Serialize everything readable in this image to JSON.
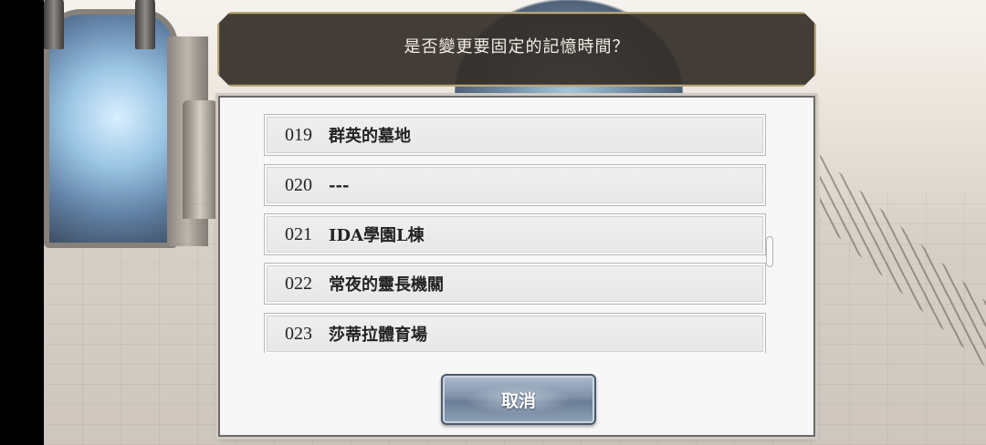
{
  "prompt": {
    "text": "是否變更要固定的記憶時間？"
  },
  "memory_list": {
    "items": [
      {
        "number": "019",
        "name": "群英的墓地"
      },
      {
        "number": "020",
        "name": "---"
      },
      {
        "number": "021",
        "name": "IDA學園L棟"
      },
      {
        "number": "022",
        "name": "常夜的靈長機關"
      },
      {
        "number": "023",
        "name": "莎蒂拉體育場"
      }
    ]
  },
  "buttons": {
    "cancel_label": "取消"
  },
  "colors": {
    "banner_bg": "#342e28",
    "banner_border": "#b8a77c",
    "panel_bg": "#f7f7f7",
    "row_bg": "#e9e9e9",
    "button_blue": "#7f91a8"
  }
}
